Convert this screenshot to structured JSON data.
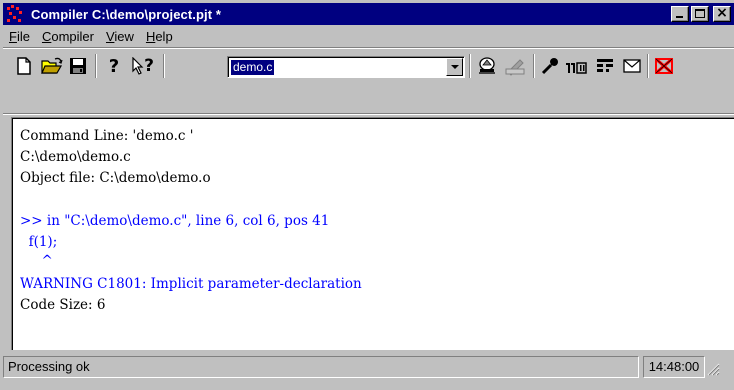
{
  "window": {
    "title": "Compiler  C:\\demo\\project.pjt *"
  },
  "menu": {
    "items": [
      {
        "label": "File",
        "hotkey": "F",
        "rest": "ile"
      },
      {
        "label": "Compiler",
        "hotkey": "C",
        "rest": "ompiler"
      },
      {
        "label": "View",
        "hotkey": "V",
        "rest": "iew"
      },
      {
        "label": "Help",
        "hotkey": "H",
        "rest": "elp"
      }
    ]
  },
  "toolbar": {
    "file_combo_value": "demo.c",
    "help_glyph": "?",
    "context_help_glyph": "?"
  },
  "output": {
    "lines": [
      {
        "text": "Command Line: 'demo.c '",
        "color": "black"
      },
      {
        "text": "C:\\demo\\demo.c",
        "color": "black"
      },
      {
        "text": "Object file: C:\\demo\\demo.o",
        "color": "black"
      },
      {
        "text": ">> in \"C:\\demo\\demo.c\", line 6, col 6, pos 41",
        "color": "blue"
      },
      {
        "text": "  f(1);",
        "color": "blue"
      },
      {
        "text": "     ^",
        "color": "blue"
      },
      {
        "text": "WARNING C1801: Implicit parameter-declaration",
        "color": "blue"
      },
      {
        "text": "Code Size: 6",
        "color": "black"
      }
    ]
  },
  "status": {
    "text": "Processing ok",
    "time": "14:48:00"
  },
  "colors": {
    "title_bar": "#000080",
    "face": "#c0c0c0",
    "output_blue": "#0000ff"
  }
}
